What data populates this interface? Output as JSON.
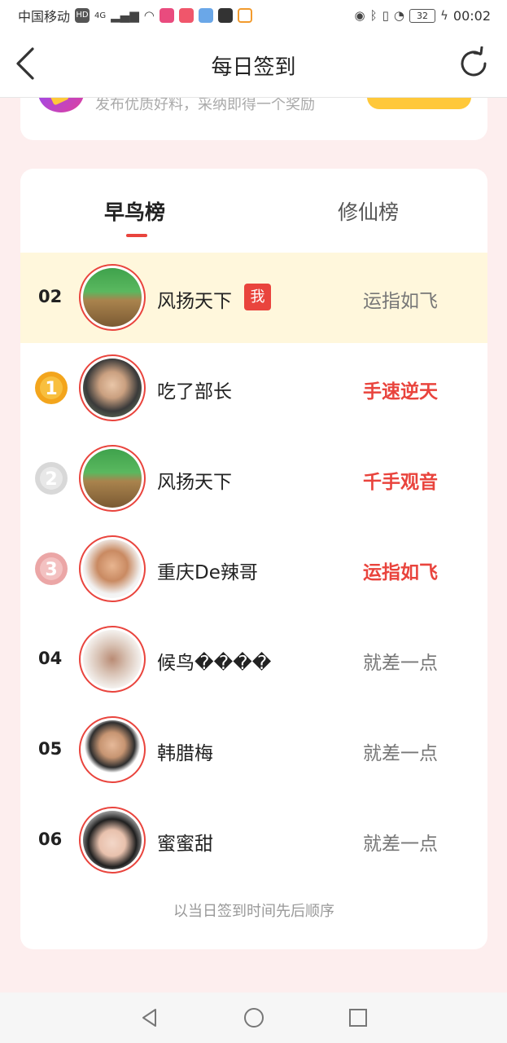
{
  "status_bar": {
    "carrier": "中国移动",
    "hd": "HD",
    "network": "4G",
    "battery": "32",
    "time": "00:02"
  },
  "header": {
    "title": "每日签到",
    "back_icon": "chevron-left-icon",
    "refresh_icon": "refresh-icon"
  },
  "promo": {
    "text": "发布优质好料，采纳即得一个奖励"
  },
  "tabs": [
    {
      "label": "早鸟榜",
      "active": true
    },
    {
      "label": "修仙榜",
      "active": false
    }
  ],
  "me_badge": "我",
  "rows": [
    {
      "rank": "02",
      "name": "风扬天下",
      "status": "运指如飞",
      "is_me": true,
      "medal": null
    },
    {
      "rank": "1",
      "name": "吃了部长",
      "status": "手速逆天",
      "is_me": false,
      "medal": "gold"
    },
    {
      "rank": "2",
      "name": "风扬天下",
      "status": "千手观音",
      "is_me": false,
      "medal": "silver"
    },
    {
      "rank": "3",
      "name": "重庆De辣哥",
      "status": "运指如飞",
      "is_me": false,
      "medal": "bronze"
    },
    {
      "rank": "04",
      "name": "候鸟����",
      "status": "就差一点",
      "is_me": false,
      "medal": null
    },
    {
      "rank": "05",
      "name": "韩腊梅",
      "status": "就差一点",
      "is_me": false,
      "medal": null
    },
    {
      "rank": "06",
      "name": "蜜蜜甜",
      "status": "就差一点",
      "is_me": false,
      "medal": null
    }
  ],
  "footer_note": "以当日签到时间先后顺序",
  "colors": {
    "accent": "#e9443d",
    "highlight_row": "#fff7dc",
    "page_bg": "#fdeeee",
    "promo_button": "#ffc83a",
    "gold": "#f3a51c",
    "silver": "#d8d8d8",
    "bronze": "#eba6a6"
  },
  "nav_bar": {
    "back_icon": "triangle-back-icon",
    "home_icon": "circle-home-icon",
    "recents_icon": "square-recents-icon"
  }
}
